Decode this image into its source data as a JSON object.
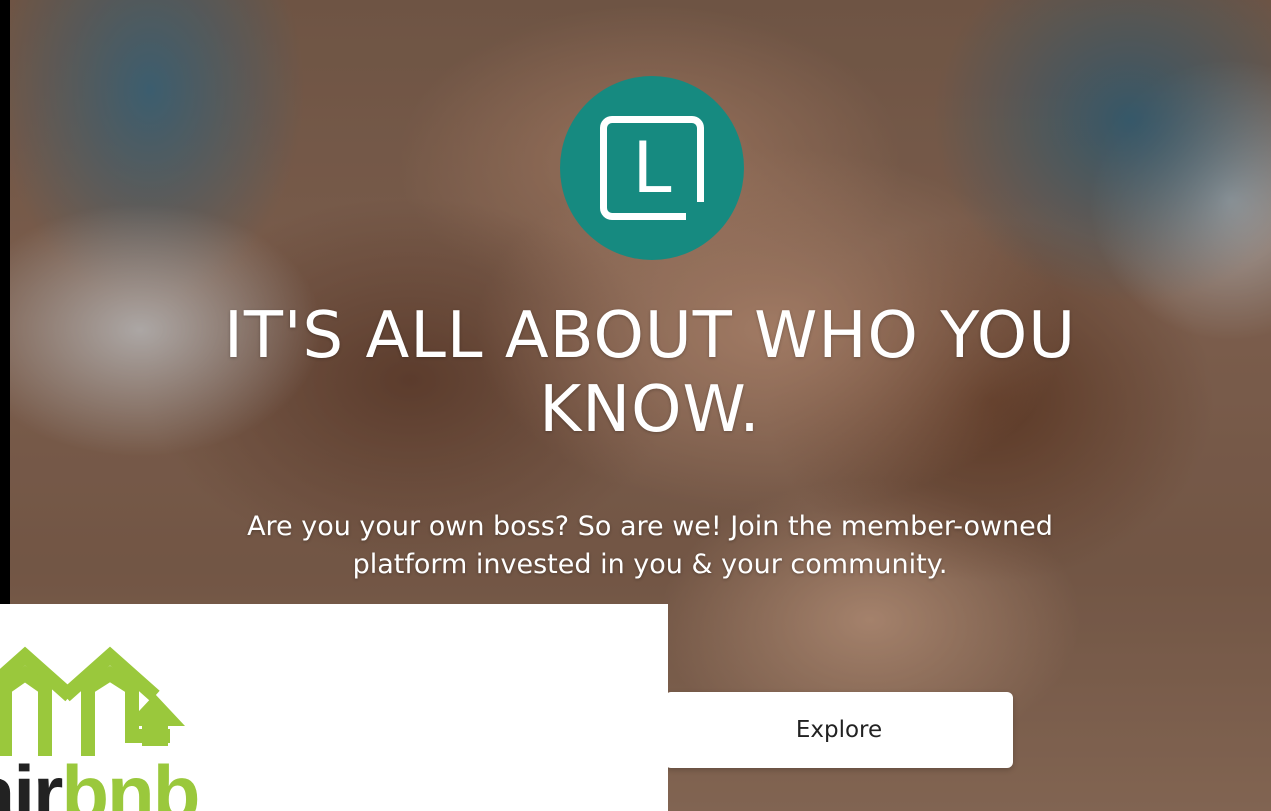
{
  "hero": {
    "logo_letter": "L",
    "headline_line1": "IT'S ALL ABOUT WHO YOU",
    "headline_line2": "KNOW.",
    "subtext_line1": "Are you your own boss? So are we! Join the member-owned",
    "subtext_line2": "platform invested in you & your community.",
    "explore_label": "Explore",
    "accent_color": "#168a80"
  },
  "overlay": {
    "brand_text_part1": "air",
    "brand_text_part2": "bnb",
    "logo_icon": "houses-arrow-icon",
    "logo_color": "#9ac83c"
  }
}
